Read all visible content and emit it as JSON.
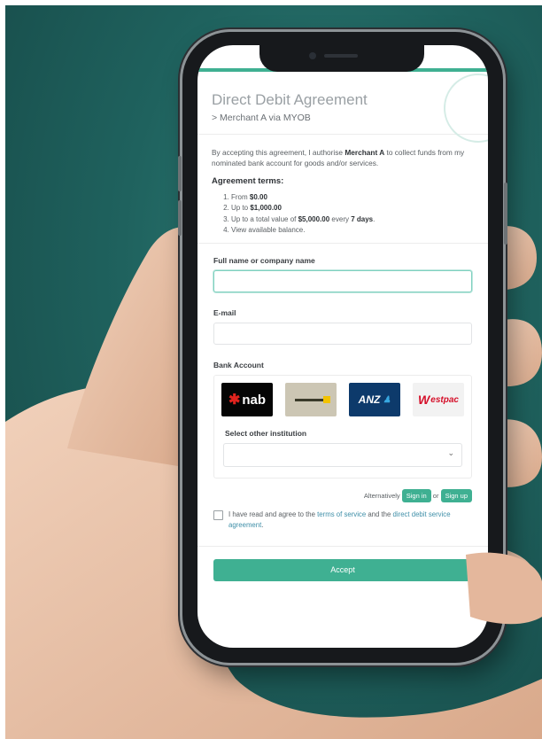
{
  "agreement": {
    "title": "Direct Debit Agreement",
    "subtitle": "> Merchant A via MYOB",
    "intro_before": "By accepting this agreement, I authorise ",
    "intro_merchant": "Merchant A",
    "intro_after": " to collect funds from my nominated bank account for goods and/or services.",
    "terms_heading": "Agreement terms:",
    "terms": [
      {
        "prefix": "From ",
        "value": "$0.00",
        "suffix": ""
      },
      {
        "prefix": "Up to ",
        "value": "$1,000.00",
        "suffix": ""
      },
      {
        "prefix": "Up to a total value of ",
        "value": "$5,000.00",
        "mid": " every ",
        "value2": "7 days",
        "suffix": "."
      },
      {
        "prefix": "View available balance.",
        "value": "",
        "suffix": ""
      }
    ]
  },
  "form": {
    "name_label": "Full name or company name",
    "name_value": "",
    "email_label": "E-mail",
    "email_value": "",
    "bank_label": "Bank Account",
    "banks": [
      "nab",
      "CommBank",
      "ANZ",
      "Westpac"
    ],
    "bank_westpac_w": "W",
    "bank_westpac_rest": "estpac",
    "other_label": "Select other institution",
    "other_value": "",
    "alt_text": "Alternatively",
    "signin_label": "Sign in",
    "or_text": "or",
    "signup_label": "Sign up",
    "agree_before": "I have read and agree to the ",
    "terms_link": "terms of service",
    "agree_mid": " and the ",
    "dd_link": "direct debit service agreement",
    "agree_after": ".",
    "accept_label": "Accept"
  },
  "colors": {
    "accent": "#3fb092",
    "background": "#1f625e",
    "nab": "#050505",
    "anz": "#0d3a6b",
    "westpac_red": "#d5102a"
  },
  "icons": [
    "chevron-down-icon",
    "nab-star-icon",
    "anz-people-icon"
  ]
}
